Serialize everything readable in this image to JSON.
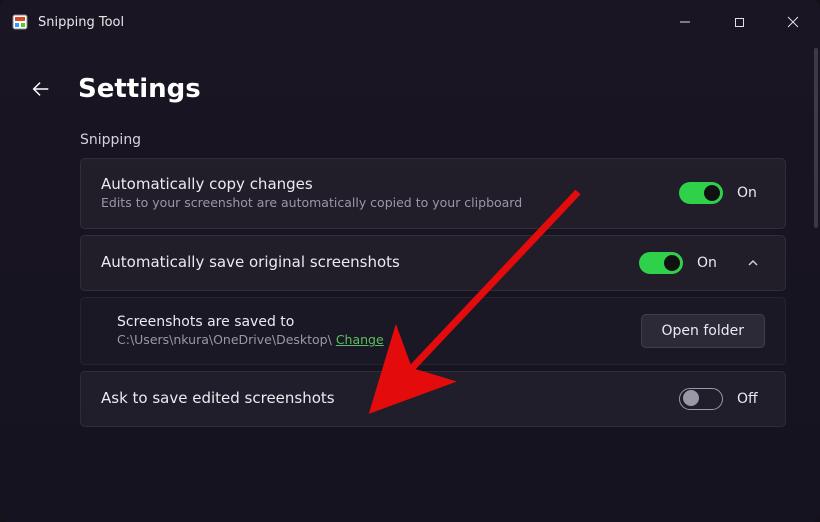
{
  "titlebar": {
    "app_name": "Snipping Tool"
  },
  "page": {
    "title": "Settings",
    "section_label": "Snipping"
  },
  "settings": {
    "auto_copy": {
      "title": "Automatically copy changes",
      "subtitle": "Edits to your screenshot are automatically copied to your clipboard",
      "toggle_state": "On"
    },
    "auto_save": {
      "title": "Automatically save original screenshots",
      "toggle_state": "On",
      "expanded": true,
      "sub": {
        "title": "Screenshots are saved to",
        "path": "C:\\Users\\nkura\\OneDrive\\Desktop\\",
        "change_label": "Change",
        "open_folder_label": "Open folder"
      }
    },
    "ask_save": {
      "title": "Ask to save edited screenshots",
      "toggle_state": "Off"
    }
  },
  "colors": {
    "toggle_on": "#2fd04a",
    "accent_link": "#5bbf5f",
    "annotation_arrow": "#e30b0b"
  }
}
